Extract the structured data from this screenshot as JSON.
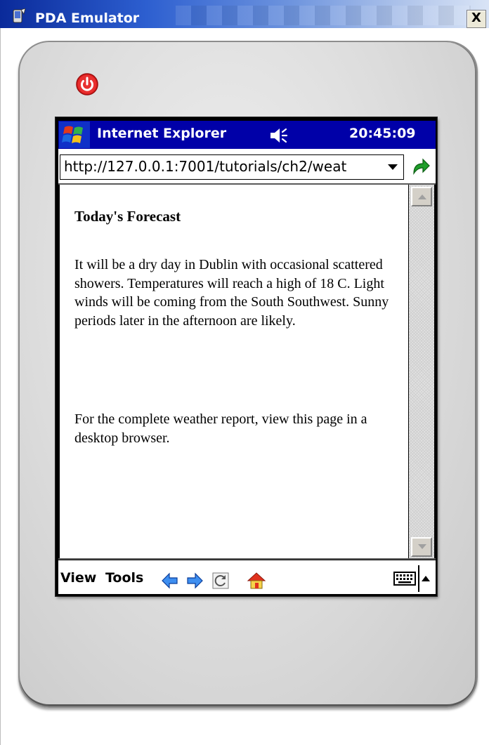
{
  "window": {
    "title": "PDA Emulator",
    "close_label": "X",
    "accent": "#0a2a9a"
  },
  "device": {
    "power_icon": "power-icon",
    "status_bar": {
      "app_name": "Internet Explorer",
      "time": "20:45:09",
      "color": "#0000a8",
      "icons": [
        "windows-start-icon",
        "speaker-icon"
      ]
    },
    "address_bar": {
      "url": "http://127.0.0.1:7001/tutorials/ch2/weat",
      "dropdown_icon": "chevron-down-icon",
      "go_icon": "go-arrow-icon"
    },
    "page": {
      "heading": "Today's Forecast",
      "paragraphs": [
        "It will be a dry day in Dublin with occasional scattered showers. Temperatures will reach a high of 18 C. Light winds will be coming from the South Southwest. Sunny periods later in the afternoon are likely.",
        "For the complete weather report, view this page in a desktop browser."
      ]
    },
    "toolbar": {
      "menus": [
        "View",
        "Tools"
      ],
      "icons": [
        "back-icon",
        "forward-icon",
        "refresh-icon",
        "home-icon",
        "keyboard-icon",
        "sip-arrow-icon"
      ]
    }
  }
}
